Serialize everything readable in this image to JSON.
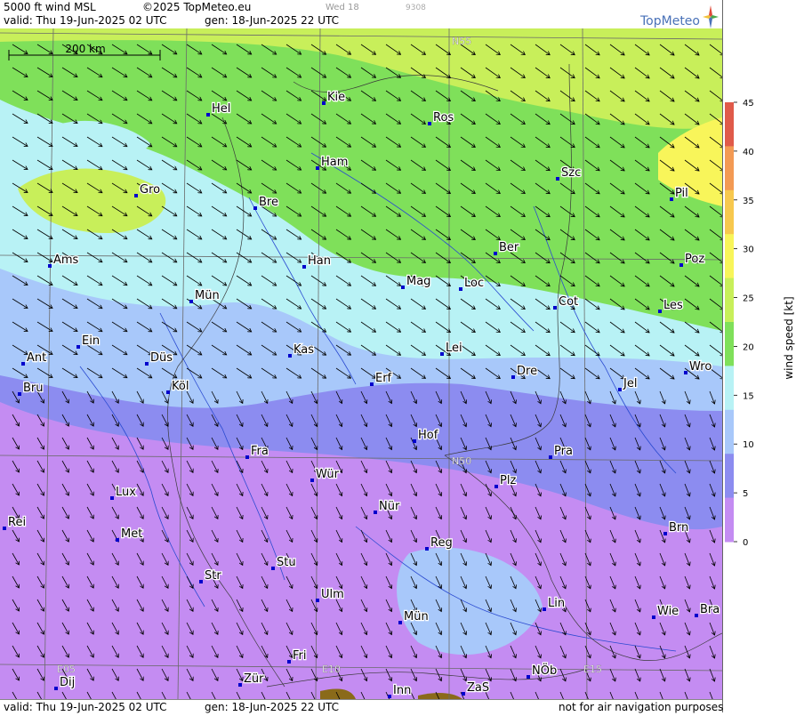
{
  "header": {
    "product": "5000 ft wind MSL",
    "copyright": "©2025 TopMeteo.eu",
    "run_day": "Wed 18",
    "run_code": "9308",
    "valid": "valid:  Thu  19-Jun-2025  02 UTC",
    "generated": "gen: 18-Jun-2025 22 UTC",
    "logo": "TopMeteo"
  },
  "footer": {
    "valid": "valid:  Thu  19-Jun-2025  02 UTC",
    "generated": "gen: 18-Jun-2025 22 UTC",
    "disclaimer": "not for air navigation purposes"
  },
  "scale_bar": {
    "label": "200 km"
  },
  "grid_labels": {
    "lat_55": "N55",
    "lat_50": "N50",
    "lon_05": "E05",
    "lon_10": "E10",
    "lon_15": "E15"
  },
  "legend": {
    "title": "wind speed  [kt]",
    "ticks": [
      "45",
      "40",
      "35",
      "30",
      "25",
      "20",
      "15",
      "10",
      "5",
      "0"
    ],
    "colors": [
      "#e05a4a",
      "#f39a54",
      "#f7c84e",
      "#f8f55a",
      "#c8ef5a",
      "#7fe05a",
      "#b8f2f5",
      "#a8c8fa",
      "#8c8cf0",
      "#c48cf2"
    ]
  },
  "cities": [
    {
      "name": "Kie"
    },
    {
      "name": "Hel"
    },
    {
      "name": "Ros"
    },
    {
      "name": "Ham"
    },
    {
      "name": "Szc"
    },
    {
      "name": "Gro"
    },
    {
      "name": "Bre"
    },
    {
      "name": "Pil"
    },
    {
      "name": "Ber"
    },
    {
      "name": "Ams"
    },
    {
      "name": "Han"
    },
    {
      "name": "Poz"
    },
    {
      "name": "Mag"
    },
    {
      "name": "Loc"
    },
    {
      "name": "Mün"
    },
    {
      "name": "Cot"
    },
    {
      "name": "Les"
    },
    {
      "name": "Ein"
    },
    {
      "name": "Kas"
    },
    {
      "name": "Lei"
    },
    {
      "name": "Ant"
    },
    {
      "name": "Düs"
    },
    {
      "name": "Wro"
    },
    {
      "name": "Dre"
    },
    {
      "name": "Erf"
    },
    {
      "name": "Bru"
    },
    {
      "name": "Köl"
    },
    {
      "name": "Jel"
    },
    {
      "name": "Hof"
    },
    {
      "name": "Fra"
    },
    {
      "name": "Pra"
    },
    {
      "name": "Wür"
    },
    {
      "name": "Plz"
    },
    {
      "name": "Lux"
    },
    {
      "name": "Nür"
    },
    {
      "name": "Rei"
    },
    {
      "name": "Met"
    },
    {
      "name": "Brn"
    },
    {
      "name": "Reg"
    },
    {
      "name": "Stu"
    },
    {
      "name": "Str"
    },
    {
      "name": "Ulm"
    },
    {
      "name": "Lin"
    },
    {
      "name": "Wie"
    },
    {
      "name": "Bra"
    },
    {
      "name": "Mün"
    },
    {
      "name": "Fri"
    },
    {
      "name": "Dij"
    },
    {
      "name": "Zür"
    },
    {
      "name": "NÖb"
    },
    {
      "name": "Inn"
    },
    {
      "name": "ZaS"
    }
  ]
}
